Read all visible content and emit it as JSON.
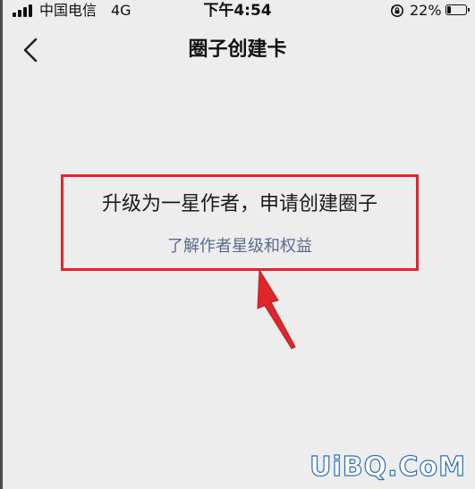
{
  "status_bar": {
    "carrier": "中国电信",
    "network": "4G",
    "time": "下午4:54",
    "battery_percent": "22%",
    "battery_level": 0.22,
    "icons": [
      "signal-icon",
      "orientation-lock-icon",
      "battery-icon"
    ]
  },
  "nav": {
    "back_icon": "chevron-left-icon",
    "title": "圈子创建卡"
  },
  "content": {
    "headline": "升级为一星作者，申请创建圈子",
    "link": "了解作者星级和权益"
  },
  "annotation": {
    "highlight_color": "#e0262b"
  },
  "colors": {
    "background": "#ededed",
    "link": "#5b6a8e",
    "highlight": "#e0262b"
  },
  "watermark": {
    "text": "UiBQ.CoM"
  }
}
